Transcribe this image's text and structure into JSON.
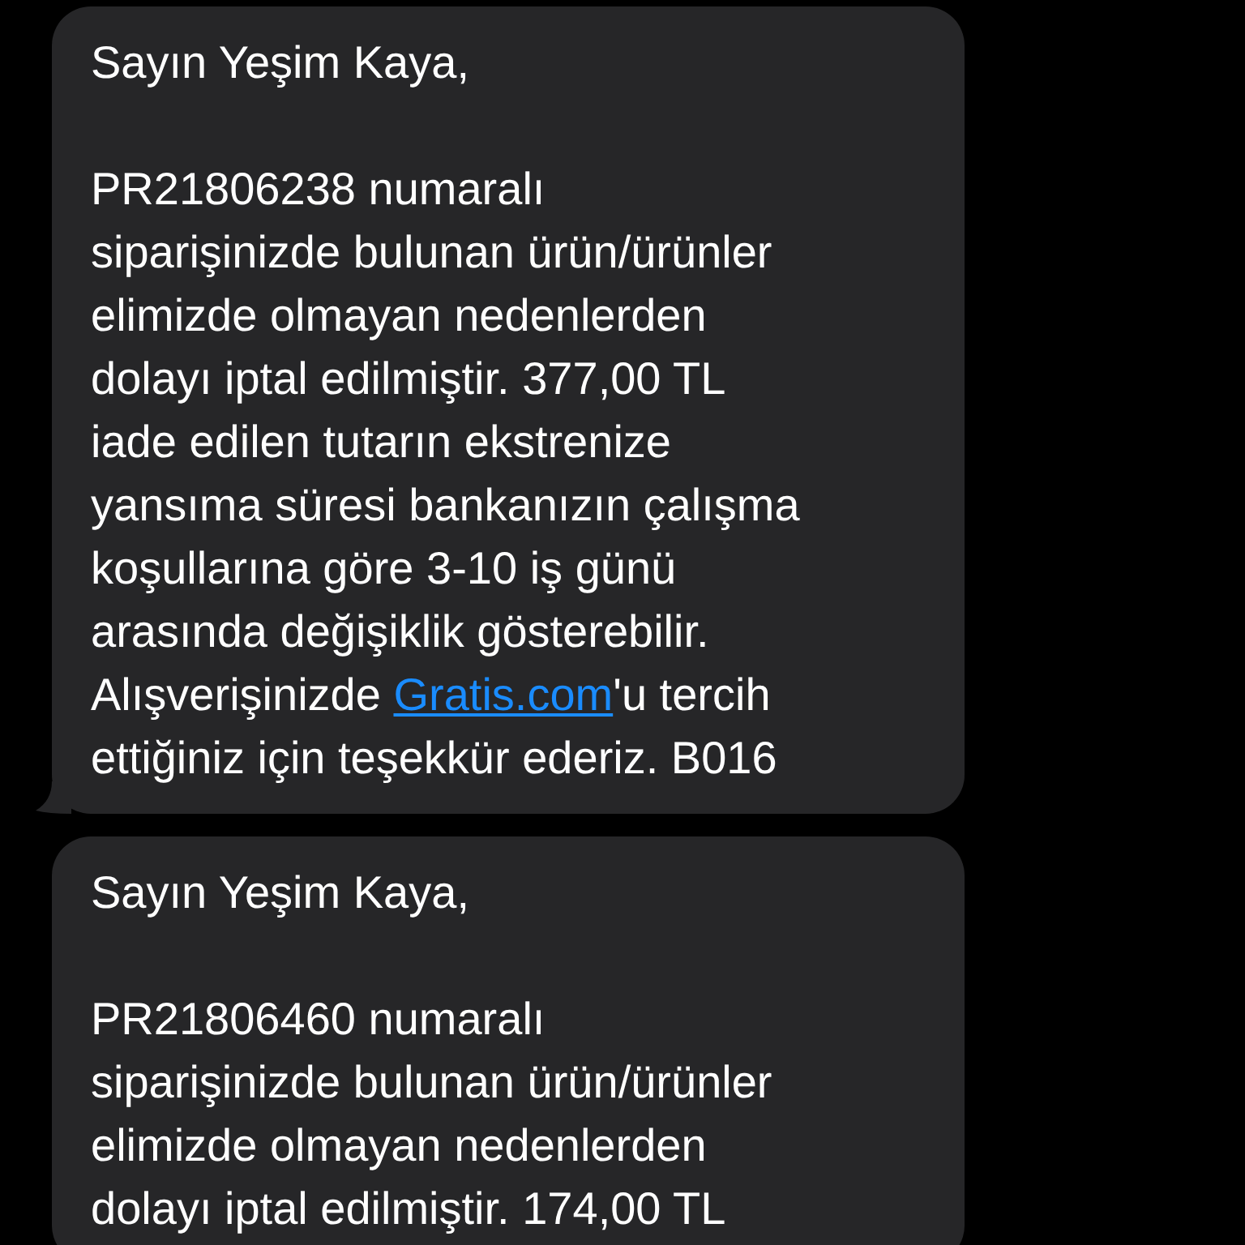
{
  "messages": [
    {
      "greeting": "Sayın Yeşim Kaya,",
      "body_before_link": "PR21806238 numaralı\nsiparişinizde bulunan ürün/ürünler\nelimizde olmayan nedenlerden\ndolayı iptal edilmiştir. 377,00 TL\niade edilen tutarın ekstrenize\nyansıma süresi bankanızın çalışma\nkoşullarına göre 3-10 iş günü\narasında değişiklik gösterebilir.\nAlışverişinizde ",
      "link": "Gratis.com",
      "body_after_link": "'u tercih\nettiğiniz için teşekkür ederiz. B016",
      "tail": true
    },
    {
      "greeting": "Sayın Yeşim Kaya,",
      "body_before_link": "PR21806460 numaralı\nsiparişinizde bulunan ürün/ürünler\nelimizde olmayan nedenlerden\ndolayı iptal edilmiştir. 174,00 TL",
      "tail": false
    }
  ]
}
